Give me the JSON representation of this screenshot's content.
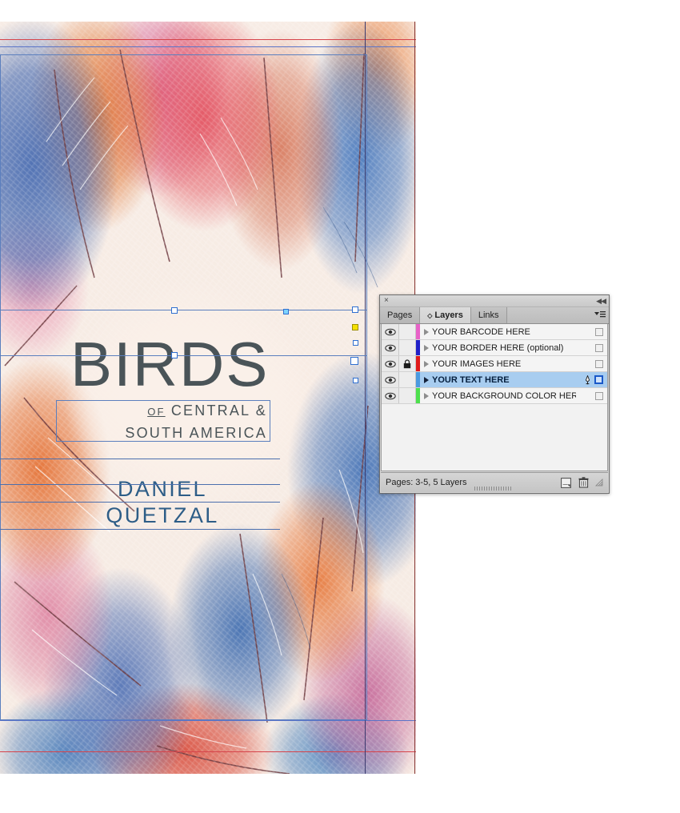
{
  "document": {
    "cover": {
      "title": "BIRDS",
      "subtitle_line1_small": "OF",
      "subtitle_line1_rest": " CENTRAL &",
      "subtitle_line2": "SOUTH AMERICA",
      "author_line1": "DANIEL",
      "author_line2": "QUETZAL",
      "title_color": "#4a5458",
      "author_color": "#2d5d87",
      "background_color": "#f7ece5"
    },
    "guides": {
      "bleed_color": "#d6434a",
      "margin_color": "#5a74c8",
      "frame_color": "#5b7fbe",
      "baseline_color": "#4b6fae"
    }
  },
  "panel": {
    "close_glyph": "×",
    "collapse_glyph": "◀◀",
    "tabs": [
      {
        "label": "Pages",
        "active": false,
        "has_marker": false
      },
      {
        "label": "Layers",
        "active": true,
        "has_marker": true
      },
      {
        "label": "Links",
        "active": false,
        "has_marker": false
      }
    ],
    "menu_icon": "panel-menu-icon",
    "layers": [
      {
        "name": "YOUR BARCODE HERE",
        "visible": true,
        "locked": false,
        "selected": false,
        "swatch": "#e862c8",
        "targeted": false,
        "has_selection": false
      },
      {
        "name": "YOUR BORDER HERE (optional)",
        "visible": true,
        "locked": false,
        "selected": false,
        "swatch": "#2020c8",
        "targeted": false,
        "has_selection": false
      },
      {
        "name": "YOUR IMAGES HERE",
        "visible": true,
        "locked": true,
        "selected": false,
        "swatch": "#e01b1b",
        "targeted": false,
        "has_selection": false
      },
      {
        "name": "YOUR TEXT HERE",
        "visible": true,
        "locked": false,
        "selected": true,
        "swatch": "#4b9ae0",
        "targeted": true,
        "has_selection": true
      },
      {
        "name": "YOUR BACKGROUND COLOR HERE",
        "visible": true,
        "locked": false,
        "selected": false,
        "swatch": "#4de04d",
        "targeted": false,
        "has_selection": false
      }
    ],
    "status_text": "Pages: 3-5, 5 Layers",
    "new_layer_label": "new-layer-button",
    "delete_layer_label": "delete-layer-button",
    "selected_row_color": "#a8cdf0"
  }
}
